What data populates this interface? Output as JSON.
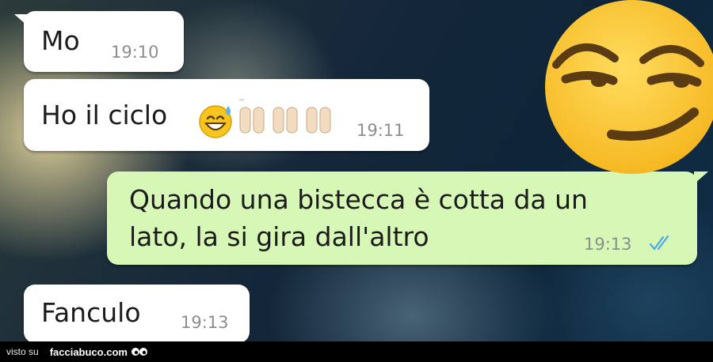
{
  "messages": [
    {
      "direction": "in",
      "text": "Mo",
      "time": "19:10"
    },
    {
      "direction": "in",
      "text": "Ho il ciclo",
      "time": "19:11",
      "emojis": [
        "grinning-sweat-emoji",
        "raised-hands-emoji",
        "raised-hands-emoji",
        "raised-hands-emoji"
      ]
    },
    {
      "direction": "out",
      "text": "Quando una bistecca è cotta da un lato, la si gira dall'altro",
      "time": "19:13",
      "status": "read-double-check"
    },
    {
      "direction": "in",
      "text": "Fanculo",
      "time": "19:13"
    }
  ],
  "overlay": {
    "icon": "smirking-face-emoji"
  },
  "colors": {
    "incoming_bubble": "#ffffff",
    "outgoing_bubble": "#d6f7b5",
    "read_ticks": "#4fa6e6",
    "timestamp": "#8b8f8c"
  },
  "footer": {
    "visto_label": "visto su",
    "site": "facciabuco.com"
  }
}
